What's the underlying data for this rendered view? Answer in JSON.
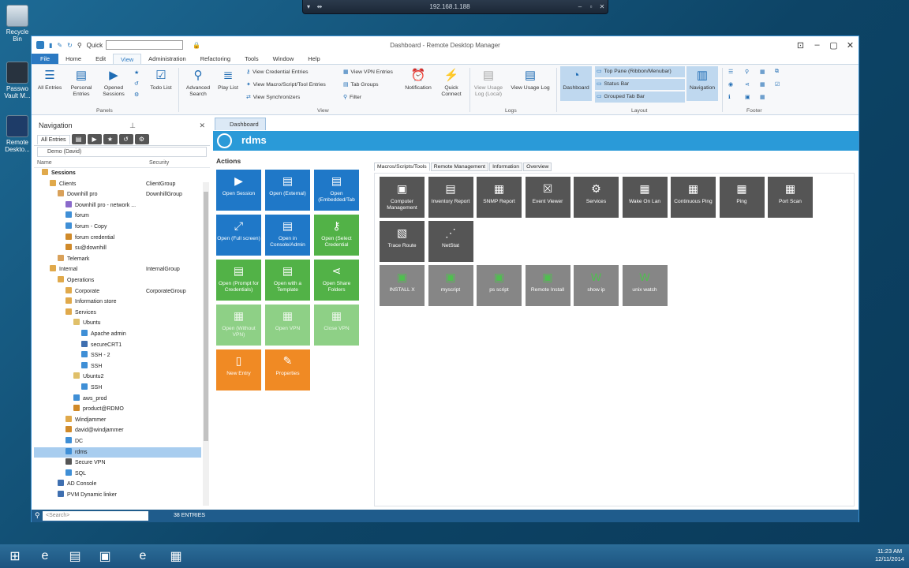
{
  "desktop": {
    "icons": [
      "Recycle Bin",
      "Passwo Vault M...",
      "Remote Deskto..."
    ]
  },
  "remote_bar": {
    "address": "192.168.1.188"
  },
  "window": {
    "title": "Dashboard - Remote Desktop Manager",
    "quick_label": "Quick"
  },
  "menu": [
    "File",
    "Home",
    "Edit",
    "View",
    "Administration",
    "Refactoring",
    "Tools",
    "Window",
    "Help"
  ],
  "ribbon": {
    "panels": [
      "All Entries",
      "Personal Entries",
      "Opened Sessions",
      "Todo List"
    ],
    "panels_label": "Panels",
    "view_big": [
      "Advanced Search",
      "Play List"
    ],
    "view_small": [
      "View Credential Entries",
      "View Macro/Script/Tool Entries",
      "View Synchronizers",
      "View VPN Entries",
      "Tab Groups",
      "Filter"
    ],
    "view_big2": [
      "Notification",
      "Quick Connect"
    ],
    "view_label": "View",
    "logs": [
      "View Usage Log (Local)",
      "View Usage Log"
    ],
    "logs_label": "Logs",
    "layout_dash": "Dashboard",
    "layout_small": [
      "Top Pane (Ribbon/Menubar)",
      "Status Bar",
      "Grouped Tab Bar"
    ],
    "layout_nav": "Navigation",
    "layout_label": "Layout",
    "footer_label": "Footer"
  },
  "nav": {
    "title": "Navigation",
    "tab": "All Entries",
    "vault": "Demo (David)",
    "col_name": "Name",
    "col_security": "Security",
    "tree": [
      {
        "n": "Sessions",
        "s": "",
        "d": 0
      },
      {
        "n": "Clients",
        "s": "ClientGroup",
        "d": 1
      },
      {
        "n": "Downhill pro",
        "s": "DownhillGroup",
        "d": 2
      },
      {
        "n": "Downhill pro - network ...",
        "s": "",
        "d": 3
      },
      {
        "n": "forum",
        "s": "",
        "d": 3
      },
      {
        "n": "forum - Copy",
        "s": "",
        "d": 3
      },
      {
        "n": "forum credential",
        "s": "",
        "d": 3
      },
      {
        "n": "su@downhill",
        "s": "",
        "d": 3
      },
      {
        "n": "Telemark",
        "s": "",
        "d": 2
      },
      {
        "n": "Internal",
        "s": "InternalGroup",
        "d": 1
      },
      {
        "n": "Operations",
        "s": "",
        "d": 2
      },
      {
        "n": "Corporate",
        "s": "CorporateGroup",
        "d": 3
      },
      {
        "n": "Information store",
        "s": "",
        "d": 3
      },
      {
        "n": "Services",
        "s": "",
        "d": 3
      },
      {
        "n": "Ubuntu",
        "s": "",
        "d": 4
      },
      {
        "n": "Apache admin",
        "s": "",
        "d": 5
      },
      {
        "n": "secureCRT1",
        "s": "",
        "d": 5
      },
      {
        "n": "SSH - 2",
        "s": "",
        "d": 5
      },
      {
        "n": "SSH",
        "s": "",
        "d": 5
      },
      {
        "n": "Ubuntu2",
        "s": "",
        "d": 4
      },
      {
        "n": "SSH",
        "s": "",
        "d": 5
      },
      {
        "n": "aws_prod",
        "s": "",
        "d": 4
      },
      {
        "n": "product@RDMO",
        "s": "",
        "d": 4
      },
      {
        "n": "Windjammer",
        "s": "",
        "d": 3
      },
      {
        "n": "david@windjammer",
        "s": "",
        "d": 3
      },
      {
        "n": "DC",
        "s": "",
        "d": 3
      },
      {
        "n": "rdms",
        "s": "",
        "d": 3
      },
      {
        "n": "Secure VPN",
        "s": "",
        "d": 3
      },
      {
        "n": "SQL",
        "s": "",
        "d": 3
      },
      {
        "n": "AD Console",
        "s": "",
        "d": 2
      },
      {
        "n": "PVM Dynamic linker",
        "s": "",
        "d": 2
      }
    ]
  },
  "dash": {
    "tab": "Dashboard",
    "entry": "rdms",
    "actions_title": "Actions",
    "actions": [
      {
        "l": "Open Session",
        "c": "blue"
      },
      {
        "l": "Open (External)",
        "c": "blue"
      },
      {
        "l": "Open (Embedded/Tab",
        "c": "blue"
      },
      {
        "l": "Open (Full screen)",
        "c": "blue"
      },
      {
        "l": "Open in Console/Admin",
        "c": "blue"
      },
      {
        "l": "Open (Select Credential",
        "c": "green"
      },
      {
        "l": "Open (Prompt for Credentials)",
        "c": "green"
      },
      {
        "l": "Open with a Template",
        "c": "green"
      },
      {
        "l": "Open Share Folders",
        "c": "green"
      },
      {
        "l": "Open (Without VPN)",
        "c": "lgreen"
      },
      {
        "l": "Open VPN",
        "c": "lgreen"
      },
      {
        "l": "Close VPN",
        "c": "lgreen"
      },
      {
        "l": "New Entry",
        "c": "orange"
      },
      {
        "l": "Properties",
        "c": "orange"
      }
    ],
    "tabs": [
      "Macros/Scripts/Tools",
      "Remote Management",
      "Information",
      "Overview"
    ],
    "tools": [
      "Computer Management",
      "Inventory Report",
      "SNMP Report",
      "Event Viewer",
      "Services",
      "Wake On Lan",
      "Continuous Ping",
      "Ping",
      "Port Scan",
      "Trace Route",
      "NetStat"
    ],
    "scripts": [
      "INSTALL X",
      "myscript",
      "ps script",
      "Remote Install",
      "show ip",
      "unix watch"
    ]
  },
  "status": {
    "search_placeholder": "<Search>",
    "entries": "38 ENTRIES"
  },
  "clock": {
    "time": "11:23 AM",
    "date": "12/11/2014"
  }
}
